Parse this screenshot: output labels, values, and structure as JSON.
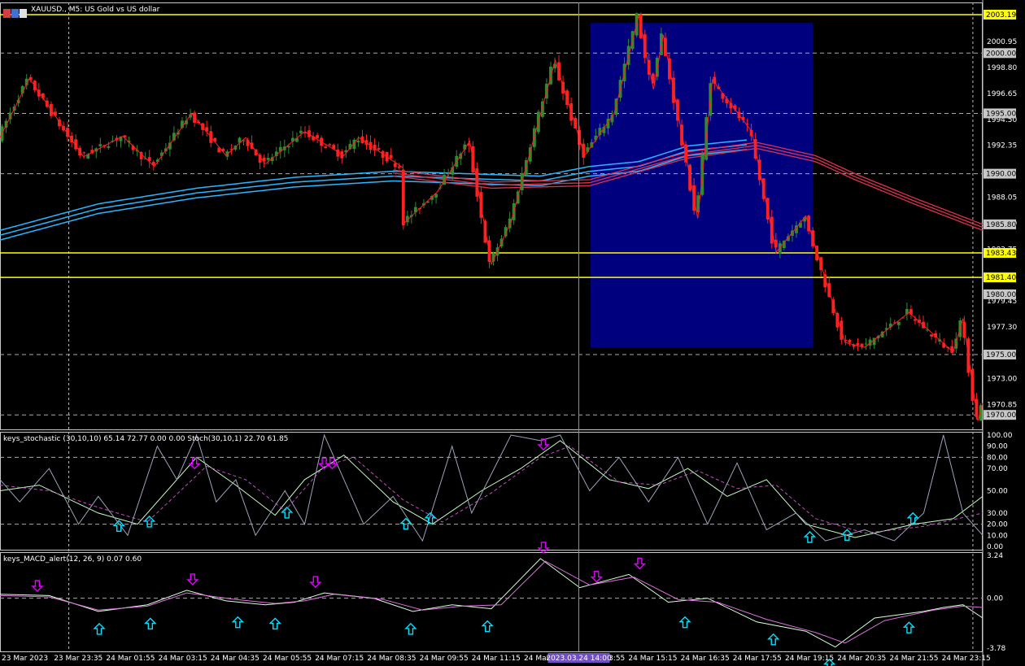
{
  "header": {
    "title": "XAUUSD., M5:  US Gold vs US dollar",
    "stoch_title": "keys_stochastic (30,10,10) 65.14 72.77 0.00 0.00 Stoch(30,10,1) 22.70 61.85",
    "macd_title": "keys_MACD_alert(12, 26, 9) 0.07 0.60"
  },
  "colors": {
    "background": "#000000",
    "bull": "#2e8b2e",
    "bear": "#ff2020",
    "zigzag": "#ff2020",
    "ma_blue": "#2bb5ff",
    "ma_red": "#e03050",
    "hline": "#ffff00",
    "zone": "#00007f",
    "stoch_main": "#c8ffc8",
    "stoch_signal": "#c050c0",
    "stoch_fast": "#9aa4b8",
    "macd_main": "#d8ffd8",
    "macd_signal": "#e070e0",
    "arrow_up": "#00e0ff",
    "arrow_down": "#e000ff",
    "crosshair": "#a070ff"
  },
  "chart_data": [
    {
      "type": "candlestick",
      "title": "XAUUSD., M5:  US Gold vs US dollar",
      "ylim": [
        1968.8,
        2004.2
      ],
      "y_ticks": [
        "2000.95",
        "1998.80",
        "1996.65",
        "1994.50",
        "1992.35",
        "1988.05",
        "1985.90",
        "1983.75",
        "1979.45",
        "1977.30",
        "1973.00",
        "1970.85"
      ],
      "price_labels": [
        "2003.19",
        "2000.00",
        "1995.00",
        "1990.00",
        "1985.80",
        "1983.43",
        "1981.40",
        "1980.00",
        "1975.00",
        "1970.00"
      ],
      "horizontal_lines": [
        2003.19,
        1983.43,
        1981.4
      ],
      "grid_levels": [
        2000.0,
        1995.0,
        1990.0,
        1975.0,
        1970.0
      ],
      "zone": {
        "start": "24 Mar 14:55",
        "end": "24 Mar 19:55",
        "high": 2002.5,
        "low": 1975.6
      },
      "path": [
        {
          "t": 0,
          "p": 1993.0
        },
        {
          "t": 0.03,
          "p": 1997.9
        },
        {
          "t": 0.085,
          "p": 1991.4
        },
        {
          "t": 0.125,
          "p": 1993.1
        },
        {
          "t": 0.157,
          "p": 1990.6
        },
        {
          "t": 0.195,
          "p": 1995.0
        },
        {
          "t": 0.23,
          "p": 1991.5
        },
        {
          "t": 0.25,
          "p": 1993.0
        },
        {
          "t": 0.27,
          "p": 1990.8
        },
        {
          "t": 0.31,
          "p": 1993.5
        },
        {
          "t": 0.35,
          "p": 1991.5
        },
        {
          "t": 0.365,
          "p": 1993.0
        },
        {
          "t": 0.41,
          "p": 1990.5
        },
        {
          "t": 0.41,
          "p": 1990.8
        },
        {
          "t": 0.41,
          "p": 1985.8
        },
        {
          "t": 0.445,
          "p": 1988.5
        },
        {
          "t": 0.478,
          "p": 1992.7
        },
        {
          "t": 0.5,
          "p": 1982.5
        },
        {
          "t": 0.52,
          "p": 1986.0
        },
        {
          "t": 0.565,
          "p": 1999.4
        },
        {
          "t": 0.595,
          "p": 1991.5
        },
        {
          "t": 0.625,
          "p": 1995.0
        },
        {
          "t": 0.65,
          "p": 2003.1
        },
        {
          "t": 0.665,
          "p": 1997.0
        },
        {
          "t": 0.675,
          "p": 2001.5
        },
        {
          "t": 0.71,
          "p": 1986.3
        },
        {
          "t": 0.725,
          "p": 1997.8
        },
        {
          "t": 0.765,
          "p": 1993.5
        },
        {
          "t": 0.79,
          "p": 1983.5
        },
        {
          "t": 0.82,
          "p": 1986.5
        },
        {
          "t": 0.86,
          "p": 1976.0
        },
        {
          "t": 0.88,
          "p": 1975.6
        },
        {
          "t": 0.925,
          "p": 1978.5
        },
        {
          "t": 0.97,
          "p": 1975.2
        },
        {
          "t": 0.98,
          "p": 1978.0
        },
        {
          "t": 0.995,
          "p": 1969.5
        },
        {
          "t": 1,
          "p": 1971.0
        }
      ],
      "ma_blue": [
        {
          "t": 0,
          "p": 1985.3
        },
        {
          "t": 0.1,
          "p": 1987.5
        },
        {
          "t": 0.2,
          "p": 1988.8
        },
        {
          "t": 0.3,
          "p": 1989.7
        },
        {
          "t": 0.4,
          "p": 1990.2
        },
        {
          "t": 0.55,
          "p": 1989.8
        },
        {
          "t": 0.6,
          "p": 1990.6
        },
        {
          "t": 0.65,
          "p": 1991.0
        },
        {
          "t": 0.7,
          "p": 1992.3
        },
        {
          "t": 0.76,
          "p": 1992.8
        }
      ],
      "ma_red": [
        {
          "t": 0.4,
          "p": 1990.3
        },
        {
          "t": 0.5,
          "p": 1989.3
        },
        {
          "t": 0.6,
          "p": 1989.5
        },
        {
          "t": 0.7,
          "p": 1991.8
        },
        {
          "t": 0.77,
          "p": 1992.6
        },
        {
          "t": 0.83,
          "p": 1991.5
        },
        {
          "t": 0.87,
          "p": 1990.0
        },
        {
          "t": 0.93,
          "p": 1988.0
        },
        {
          "t": 1,
          "p": 1985.8
        }
      ]
    },
    {
      "type": "line",
      "title": "keys_stochastic (30,10,10) 65.14 72.77 0.00 0.00 Stoch(30,10,1) 22.70 61.85",
      "ylim": [
        0,
        100
      ],
      "y_ticks": [
        "100.00",
        "90.00",
        "80.00",
        "70.00",
        "50.00",
        "30.00",
        "20.00",
        "10.00",
        "0.00"
      ],
      "grid_levels": [
        80,
        20
      ],
      "series": [
        {
          "points": [
            {
              "t": 0,
              "v": 50
            },
            {
              "t": 0.04,
              "v": 55
            },
            {
              "t": 0.1,
              "v": 30
            },
            {
              "t": 0.14,
              "v": 20
            },
            {
              "t": 0.2,
              "v": 80
            },
            {
              "t": 0.24,
              "v": 55
            },
            {
              "t": 0.28,
              "v": 28
            },
            {
              "t": 0.31,
              "v": 60
            },
            {
              "t": 0.35,
              "v": 82
            },
            {
              "t": 0.4,
              "v": 40
            },
            {
              "t": 0.44,
              "v": 20
            },
            {
              "t": 0.49,
              "v": 50
            },
            {
              "t": 0.53,
              "v": 70
            },
            {
              "t": 0.57,
              "v": 95
            },
            {
              "t": 0.62,
              "v": 60
            },
            {
              "t": 0.66,
              "v": 52
            },
            {
              "t": 0.7,
              "v": 70
            },
            {
              "t": 0.74,
              "v": 45
            },
            {
              "t": 0.78,
              "v": 60
            },
            {
              "t": 0.82,
              "v": 20
            },
            {
              "t": 0.87,
              "v": 8
            },
            {
              "t": 0.93,
              "v": 20
            },
            {
              "t": 0.97,
              "v": 25
            },
            {
              "t": 1,
              "v": 45
            }
          ]
        },
        {
          "points": [
            {
              "t": 0,
              "v": 55
            },
            {
              "t": 0.05,
              "v": 50
            },
            {
              "t": 0.1,
              "v": 35
            },
            {
              "t": 0.15,
              "v": 22
            },
            {
              "t": 0.21,
              "v": 72
            },
            {
              "t": 0.25,
              "v": 60
            },
            {
              "t": 0.29,
              "v": 32
            },
            {
              "t": 0.33,
              "v": 72
            },
            {
              "t": 0.36,
              "v": 80
            },
            {
              "t": 0.41,
              "v": 42
            },
            {
              "t": 0.45,
              "v": 22
            },
            {
              "t": 0.5,
              "v": 48
            },
            {
              "t": 0.55,
              "v": 80
            },
            {
              "t": 0.58,
              "v": 90
            },
            {
              "t": 0.63,
              "v": 58
            },
            {
              "t": 0.67,
              "v": 55
            },
            {
              "t": 0.71,
              "v": 68
            },
            {
              "t": 0.75,
              "v": 52
            },
            {
              "t": 0.79,
              "v": 55
            },
            {
              "t": 0.83,
              "v": 25
            },
            {
              "t": 0.88,
              "v": 12
            },
            {
              "t": 0.94,
              "v": 18
            },
            {
              "t": 1,
              "v": 30
            }
          ]
        },
        {
          "points": [
            {
              "t": 0,
              "v": 60
            },
            {
              "t": 0.02,
              "v": 40
            },
            {
              "t": 0.05,
              "v": 70
            },
            {
              "t": 0.08,
              "v": 20
            },
            {
              "t": 0.1,
              "v": 45
            },
            {
              "t": 0.13,
              "v": 10
            },
            {
              "t": 0.16,
              "v": 90
            },
            {
              "t": 0.18,
              "v": 60
            },
            {
              "t": 0.2,
              "v": 100
            },
            {
              "t": 0.22,
              "v": 40
            },
            {
              "t": 0.24,
              "v": 60
            },
            {
              "t": 0.26,
              "v": 10
            },
            {
              "t": 0.29,
              "v": 50
            },
            {
              "t": 0.31,
              "v": 20
            },
            {
              "t": 0.33,
              "v": 100
            },
            {
              "t": 0.35,
              "v": 60
            },
            {
              "t": 0.37,
              "v": 20
            },
            {
              "t": 0.4,
              "v": 45
            },
            {
              "t": 0.43,
              "v": 5
            },
            {
              "t": 0.46,
              "v": 90
            },
            {
              "t": 0.48,
              "v": 30
            },
            {
              "t": 0.52,
              "v": 100
            },
            {
              "t": 0.55,
              "v": 95
            },
            {
              "t": 0.57,
              "v": 100
            },
            {
              "t": 0.6,
              "v": 50
            },
            {
              "t": 0.63,
              "v": 80
            },
            {
              "t": 0.66,
              "v": 40
            },
            {
              "t": 0.69,
              "v": 80
            },
            {
              "t": 0.72,
              "v": 20
            },
            {
              "t": 0.75,
              "v": 75
            },
            {
              "t": 0.78,
              "v": 15
            },
            {
              "t": 0.81,
              "v": 30
            },
            {
              "t": 0.84,
              "v": 5
            },
            {
              "t": 0.88,
              "v": 15
            },
            {
              "t": 0.91,
              "v": 5
            },
            {
              "t": 0.94,
              "v": 30
            },
            {
              "t": 0.96,
              "v": 100
            },
            {
              "t": 0.98,
              "v": 30
            },
            {
              "t": 1,
              "v": 10
            }
          ]
        }
      ],
      "arrows": [
        {
          "t": 0.121,
          "dir": "up",
          "v": 18
        },
        {
          "t": 0.152,
          "dir": "up",
          "v": 22
        },
        {
          "t": 0.198,
          "dir": "down",
          "v": 75
        },
        {
          "t": 0.292,
          "dir": "up",
          "v": 30
        },
        {
          "t": 0.33,
          "dir": "down",
          "v": 75
        },
        {
          "t": 0.338,
          "dir": "down",
          "v": 75
        },
        {
          "t": 0.413,
          "dir": "up",
          "v": 20
        },
        {
          "t": 0.438,
          "dir": "up",
          "v": 25
        },
        {
          "t": 0.553,
          "dir": "down",
          "v": 92
        },
        {
          "t": 0.824,
          "dir": "up",
          "v": 8
        },
        {
          "t": 0.862,
          "dir": "up",
          "v": 10
        },
        {
          "t": 0.929,
          "dir": "up",
          "v": 25
        }
      ]
    },
    {
      "type": "line",
      "title": "keys_MACD_alert(12, 26, 9) 0.07 0.60",
      "ylim": [
        -3.78,
        3.24
      ],
      "y_ticks": [
        "3.24",
        "0.00",
        "-3.78"
      ],
      "series": [
        {
          "points": [
            {
              "t": 0,
              "v": 0.3
            },
            {
              "t": 0.05,
              "v": 0.2
            },
            {
              "t": 0.1,
              "v": -1.0
            },
            {
              "t": 0.15,
              "v": -0.5
            },
            {
              "t": 0.19,
              "v": 0.6
            },
            {
              "t": 0.23,
              "v": -0.2
            },
            {
              "t": 0.27,
              "v": -0.5
            },
            {
              "t": 0.3,
              "v": -0.3
            },
            {
              "t": 0.33,
              "v": 0.4
            },
            {
              "t": 0.38,
              "v": 0.0
            },
            {
              "t": 0.42,
              "v": -1.0
            },
            {
              "t": 0.46,
              "v": -0.5
            },
            {
              "t": 0.5,
              "v": -0.8
            },
            {
              "t": 0.55,
              "v": 3.0
            },
            {
              "t": 0.59,
              "v": 0.8
            },
            {
              "t": 0.64,
              "v": 1.8
            },
            {
              "t": 0.68,
              "v": -0.3
            },
            {
              "t": 0.72,
              "v": 0.0
            },
            {
              "t": 0.77,
              "v": -1.8
            },
            {
              "t": 0.82,
              "v": -2.5
            },
            {
              "t": 0.85,
              "v": -3.7
            },
            {
              "t": 0.89,
              "v": -1.5
            },
            {
              "t": 0.94,
              "v": -1.0
            },
            {
              "t": 0.96,
              "v": -0.7
            },
            {
              "t": 0.98,
              "v": -0.5
            },
            {
              "t": 1,
              "v": -1.5
            }
          ]
        },
        {
          "points": [
            {
              "t": 0,
              "v": 0.2
            },
            {
              "t": 0.05,
              "v": 0.1
            },
            {
              "t": 0.1,
              "v": -0.9
            },
            {
              "t": 0.15,
              "v": -0.6
            },
            {
              "t": 0.19,
              "v": 0.4
            },
            {
              "t": 0.24,
              "v": -0.1
            },
            {
              "t": 0.28,
              "v": -0.4
            },
            {
              "t": 0.31,
              "v": -0.2
            },
            {
              "t": 0.34,
              "v": 0.3
            },
            {
              "t": 0.39,
              "v": -0.1
            },
            {
              "t": 0.43,
              "v": -0.9
            },
            {
              "t": 0.47,
              "v": -0.6
            },
            {
              "t": 0.51,
              "v": -0.5
            },
            {
              "t": 0.555,
              "v": 2.8
            },
            {
              "t": 0.6,
              "v": 1.0
            },
            {
              "t": 0.645,
              "v": 1.6
            },
            {
              "t": 0.69,
              "v": -0.1
            },
            {
              "t": 0.73,
              "v": -0.3
            },
            {
              "t": 0.78,
              "v": -1.6
            },
            {
              "t": 0.83,
              "v": -2.6
            },
            {
              "t": 0.86,
              "v": -3.4
            },
            {
              "t": 0.9,
              "v": -1.7
            },
            {
              "t": 0.95,
              "v": -0.9
            },
            {
              "t": 0.98,
              "v": -0.6
            },
            {
              "t": 1,
              "v": -0.7
            }
          ]
        }
      ],
      "arrows": [
        {
          "t": 0.038,
          "dir": "down",
          "v": 0.1
        },
        {
          "t": 0.101,
          "dir": "up",
          "v": -1.0
        },
        {
          "t": 0.153,
          "dir": "up",
          "v": -0.6
        },
        {
          "t": 0.196,
          "dir": "down",
          "v": 0.6
        },
        {
          "t": 0.242,
          "dir": "up",
          "v": -0.5
        },
        {
          "t": 0.28,
          "dir": "up",
          "v": -0.6
        },
        {
          "t": 0.321,
          "dir": "down",
          "v": 0.4
        },
        {
          "t": 0.418,
          "dir": "up",
          "v": -1.0
        },
        {
          "t": 0.496,
          "dir": "up",
          "v": -0.8
        },
        {
          "t": 0.553,
          "dir": "down",
          "v": 3.0
        },
        {
          "t": 0.607,
          "dir": "down",
          "v": 0.8
        },
        {
          "t": 0.651,
          "dir": "down",
          "v": 1.8
        },
        {
          "t": 0.697,
          "dir": "up",
          "v": -0.5
        },
        {
          "t": 0.787,
          "dir": "up",
          "v": -1.8
        },
        {
          "t": 0.844,
          "dir": "up",
          "v": -3.7
        },
        {
          "t": 0.925,
          "dir": "up",
          "v": -0.9
        }
      ]
    }
  ],
  "x_axis": {
    "labels": [
      "23 Mar 2023",
      "23 Mar 23:35",
      "24 Mar 01:55",
      "24 Mar 03:15",
      "24 Mar 04:35",
      "24 Mar 05:55",
      "24 Mar 07:15",
      "24 Mar 08:35",
      "24 Mar 09:55",
      "24 Mar 11:15",
      "24 Mar 12:35",
      "24 Mar 13:55",
      "24 Mar 15:15",
      "24 Mar 16:35",
      "24 Mar 17:55",
      "24 Mar 19:15",
      "24 Mar 20:35",
      "24 Mar 21:55",
      "24 Mar 23:15"
    ],
    "crosshair_label": "2023.03.24 14:00",
    "crosshair_t": 0.589,
    "vertical_grid": [
      0.07,
      0.99
    ]
  }
}
